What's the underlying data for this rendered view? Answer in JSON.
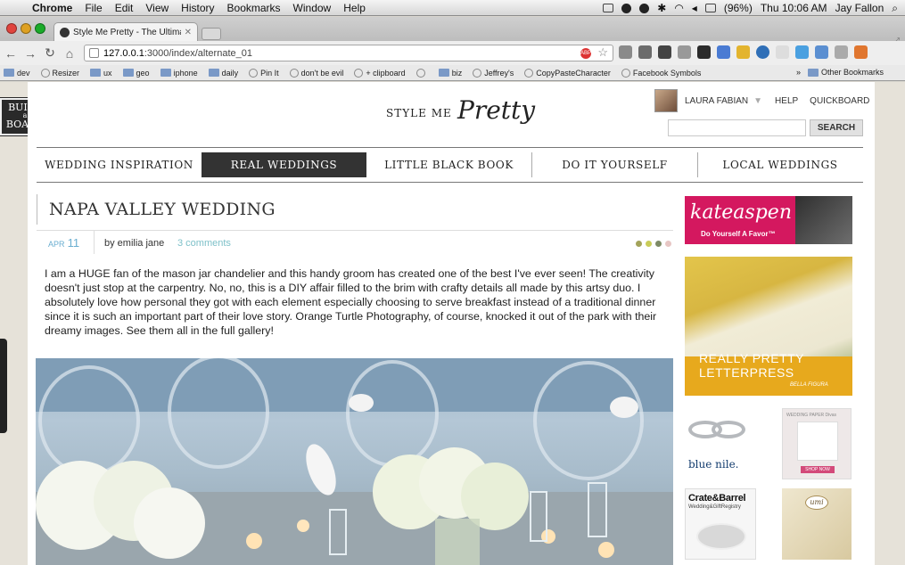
{
  "menubar": {
    "app": "Chrome",
    "items": [
      "File",
      "Edit",
      "View",
      "History",
      "Bookmarks",
      "Window",
      "Help"
    ],
    "battery": "(96%)",
    "clock": "Thu 10:06 AM",
    "user": "Jay Fallon"
  },
  "browser": {
    "tab_title": "Style Me Pretty - The Ultimat",
    "url_host": "127.0.0.1",
    "url_rest": ":3000/index/alternate_01",
    "abp_label": "ABP",
    "bookmarks": [
      {
        "label": "dev",
        "icon": "folder-icon"
      },
      {
        "label": "Resizer",
        "icon": "globe-icon"
      },
      {
        "label": "ux",
        "icon": "folder-icon"
      },
      {
        "label": "geo",
        "icon": "folder-icon"
      },
      {
        "label": "iphone",
        "icon": "folder-icon"
      },
      {
        "label": "daily",
        "icon": "folder-icon"
      },
      {
        "label": "Pin It",
        "icon": "globe-icon"
      },
      {
        "label": "don't be evil",
        "icon": "globe-icon"
      },
      {
        "label": "+ clipboard",
        "icon": "globe-icon"
      },
      {
        "label": "",
        "icon": "globe-icon"
      },
      {
        "label": "biz",
        "icon": "folder-icon"
      },
      {
        "label": "Jeffrey's",
        "icon": "globe-icon"
      },
      {
        "label": "CopyPasteCharacter",
        "icon": "globe-icon"
      },
      {
        "label": "Facebook Symbols",
        "icon": "globe-icon"
      }
    ],
    "bookmarks_overflow": "»",
    "other_bookmarks": "Other Bookmarks"
  },
  "sidebar_badge": {
    "line1": "BUILD",
    "line2": "a",
    "line3": "BOARD"
  },
  "header": {
    "logo_style": "STYLE ME",
    "logo_pretty": "Pretty",
    "user_name": "LAURA FABIAN",
    "help": "HELP",
    "quickboard": "QUICKBOARD",
    "search_placeholder": "",
    "search_button": "SEARCH"
  },
  "nav": [
    {
      "label": "WEDDING INSPIRATION",
      "active": false
    },
    {
      "label": "REAL WEDDINGS",
      "active": true
    },
    {
      "label": "LITTLE BLACK BOOK",
      "active": false
    },
    {
      "label": "DO IT YOURSELF",
      "active": false
    },
    {
      "label": "LOCAL WEDDINGS",
      "active": false
    }
  ],
  "article": {
    "title": "NAPA VALLEY WEDDING",
    "date_month": "APR",
    "date_day": "11",
    "author": "by emilia jane",
    "comments": "3 comments",
    "palette": [
      "#a3a35a",
      "#c9cc58",
      "#7d8a66",
      "#e7c6c4"
    ],
    "body": "I am a HUGE fan of the mason jar chandelier and this handy groom has created one of the best I've ever seen! The creativity doesn't just stop at the carpentry. No, no, this is a DIY affair filled to the brim with crafty details all made by this artsy duo. I absolutely love how personal they got with each element especially choosing to serve breakfast instead of a traditional dinner since it is such an important part of their love story. Orange Turtle Photography, of course, knocked it out of the park with their dreamy images. See them all in the full gallery!"
  },
  "ads": {
    "kate_title": "kateaspen",
    "kate_sub": "Do Yourself A Favor™",
    "letterpress_title": "REALLY PRETTY LETTERPRESS",
    "letterpress_sub": "BELLA FIGURA",
    "bluenile": "blue nile.",
    "wp_header": "WEDDING PAPER Divas",
    "wp_button": "SHOP NOW",
    "crate_title": "Crate&Barrel",
    "crate_sub": "Wedding&GiftRegistry",
    "invite_seal": "umi"
  }
}
